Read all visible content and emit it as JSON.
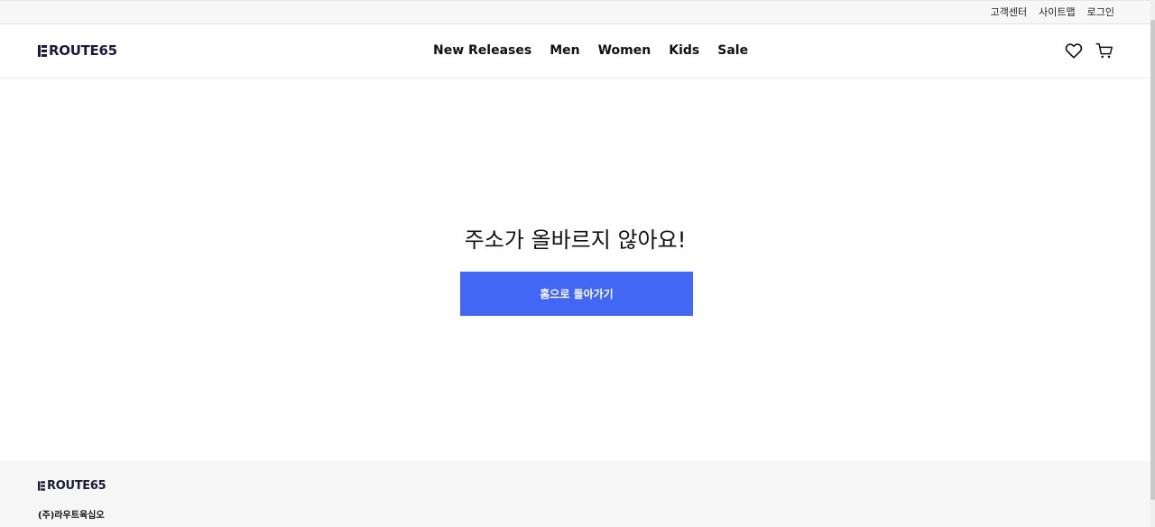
{
  "util_nav": [
    {
      "label": "고객센터"
    },
    {
      "label": "사이트맵"
    },
    {
      "label": "로그인"
    }
  ],
  "brand": {
    "name": "ROUTE65",
    "color": "#1b1a3a"
  },
  "gnb": [
    {
      "label": "New Releases"
    },
    {
      "label": "Men"
    },
    {
      "label": "Women"
    },
    {
      "label": "Kids"
    },
    {
      "label": "Sale"
    }
  ],
  "header_icons": [
    "heart-icon",
    "cart-icon"
  ],
  "error": {
    "title": "주소가 올바르지 않아요!",
    "button_label": "홈으로 돌아가기",
    "button_color": "#4267f4"
  },
  "footer": {
    "brand": "ROUTE65",
    "company": "(주)라우트육십오"
  }
}
